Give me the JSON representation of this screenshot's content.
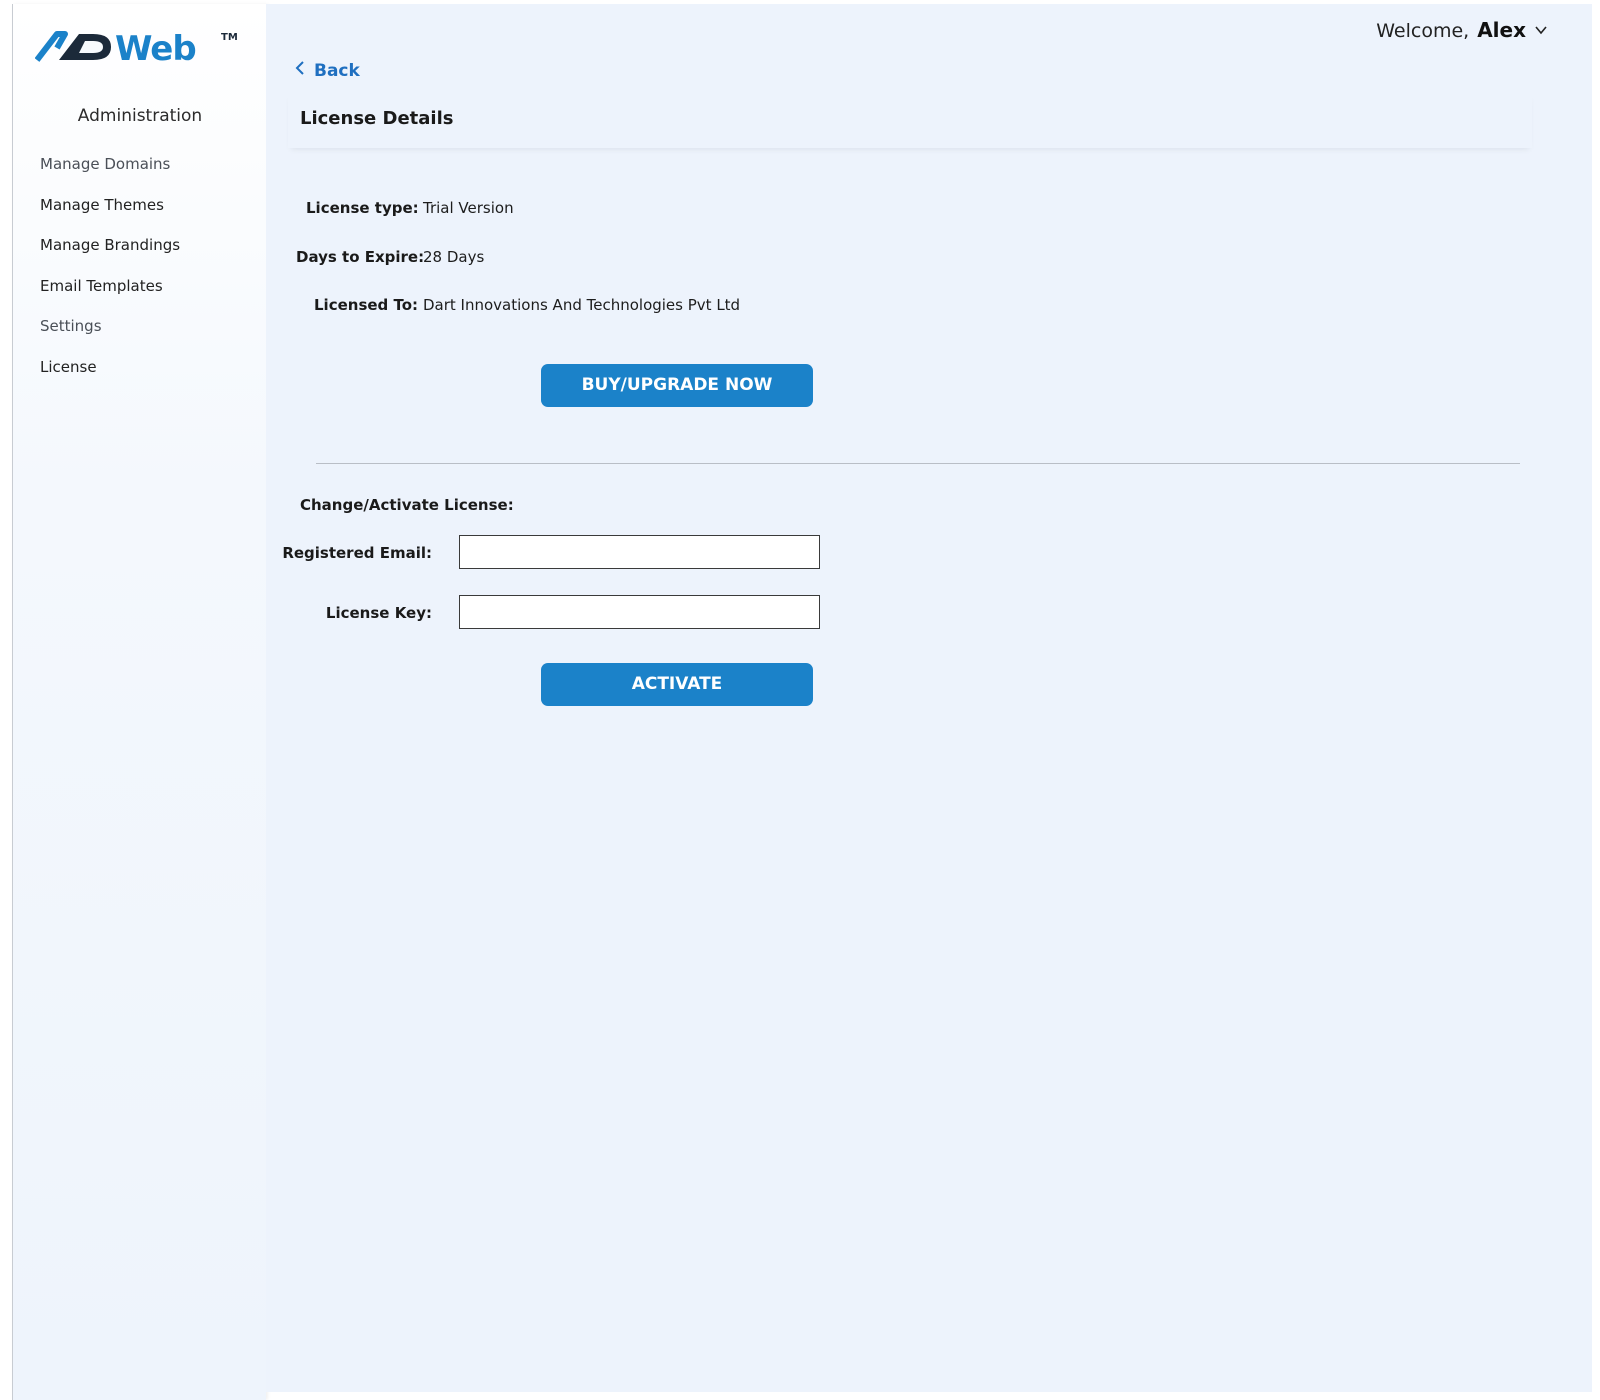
{
  "brand": {
    "logo_text": "ADWeb",
    "trademark": "TM",
    "primary_color": "#1b82c9",
    "dark_color": "#1c2a3a"
  },
  "sidebar": {
    "heading": "Administration",
    "items": [
      {
        "label": "Manage Domains"
      },
      {
        "label": "Manage Themes"
      },
      {
        "label": "Manage Brandings"
      },
      {
        "label": "Email Templates"
      },
      {
        "label": "Settings"
      },
      {
        "label": "License"
      }
    ]
  },
  "header": {
    "welcome_label": "Welcome,",
    "user_name": "Alex",
    "user_menu_icon": "chevron-down-icon"
  },
  "back": {
    "label": "Back",
    "icon": "chevron-left-icon"
  },
  "panel": {
    "title": "License Details"
  },
  "license": {
    "type_label": "License type:",
    "type_value": "Trial Version",
    "expire_label": "Days to Expire:",
    "expire_value": "28 Days",
    "licensed_to_label": "Licensed To:",
    "licensed_to_value": "Dart Innovations And Technologies Pvt Ltd",
    "buy_button": "BUY/UPGRADE NOW"
  },
  "activate": {
    "section_title": "Change/Activate License:",
    "email_label": "Registered Email:",
    "email_value": "",
    "key_label": "License Key:",
    "key_value": "",
    "activate_button": "ACTIVATE"
  }
}
